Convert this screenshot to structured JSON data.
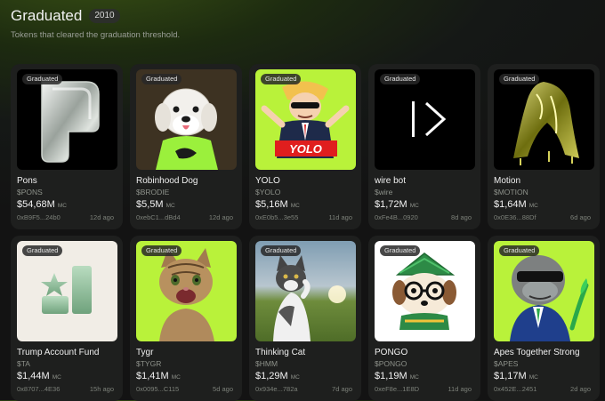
{
  "header": {
    "title": "Graduated",
    "count": "2010",
    "subtitle": "Tokens that cleared the graduation threshold."
  },
  "mc_label": "MC",
  "badge_label": "Graduated",
  "cards": [
    {
      "name": "Pons",
      "ticker": "$PONS",
      "mc": "$54,68M",
      "address": "0xB9F5...24b0",
      "age": "12d ago",
      "image": "silver-3d-p-logo",
      "bg": "#000000"
    },
    {
      "name": "Robinhood Dog",
      "ticker": "$BRODIE",
      "mc": "$5,5M",
      "address": "0xebC1...dBd4",
      "age": "12d ago",
      "image": "white-dog-green-scarf",
      "bg": "#3d3222"
    },
    {
      "name": "YOLO",
      "ticker": "$YOLO",
      "mc": "$5,16M",
      "address": "0xE0b5...3e55",
      "age": "11d ago",
      "image": "yolo-man-sunglasses",
      "bg": "#b9f23a"
    },
    {
      "name": "wire bot",
      "ticker": "$wire",
      "mc": "$1,72M",
      "address": "0xFe4B...0920",
      "age": "8d ago",
      "image": "wire-bot-logo",
      "bg": "#000000"
    },
    {
      "name": "Motion",
      "ticker": "$MOTION",
      "mc": "$1,64M",
      "address": "0x0E36...88Df",
      "age": "6d ago",
      "image": "liquid-gold-drape",
      "bg": "#000000"
    },
    {
      "name": "Trump Account Fund",
      "ticker": "$TA",
      "mc": "$1,44M",
      "address": "0x8707...4E36",
      "age": "15h ago",
      "image": "star-podium-logo",
      "bg": "#f1ede6"
    },
    {
      "name": "Tygr",
      "ticker": "$TYGR",
      "mc": "$1,41M",
      "address": "0x0095...C115",
      "age": "5d ago",
      "image": "tabby-kitten",
      "bg": "#b9f23a"
    },
    {
      "name": "Thinking Cat",
      "ticker": "$HMM",
      "mc": "$1,29M",
      "address": "0x934e...782a",
      "age": "7d ago",
      "image": "thinking-cat-field",
      "bg": "#6f8a9c"
    },
    {
      "name": "PONGO",
      "ticker": "$PONGO",
      "mc": "$1,19M",
      "address": "0xeF8e...1E8D",
      "age": "11d ago",
      "image": "dog-house-character",
      "bg": "#ffffff"
    },
    {
      "name": "Apes Together Strong",
      "ticker": "$APES",
      "mc": "$1,17M",
      "address": "0x452E...2451",
      "age": "2d ago",
      "image": "ape-suit-sunglasses",
      "bg": "#b9f23a"
    }
  ]
}
